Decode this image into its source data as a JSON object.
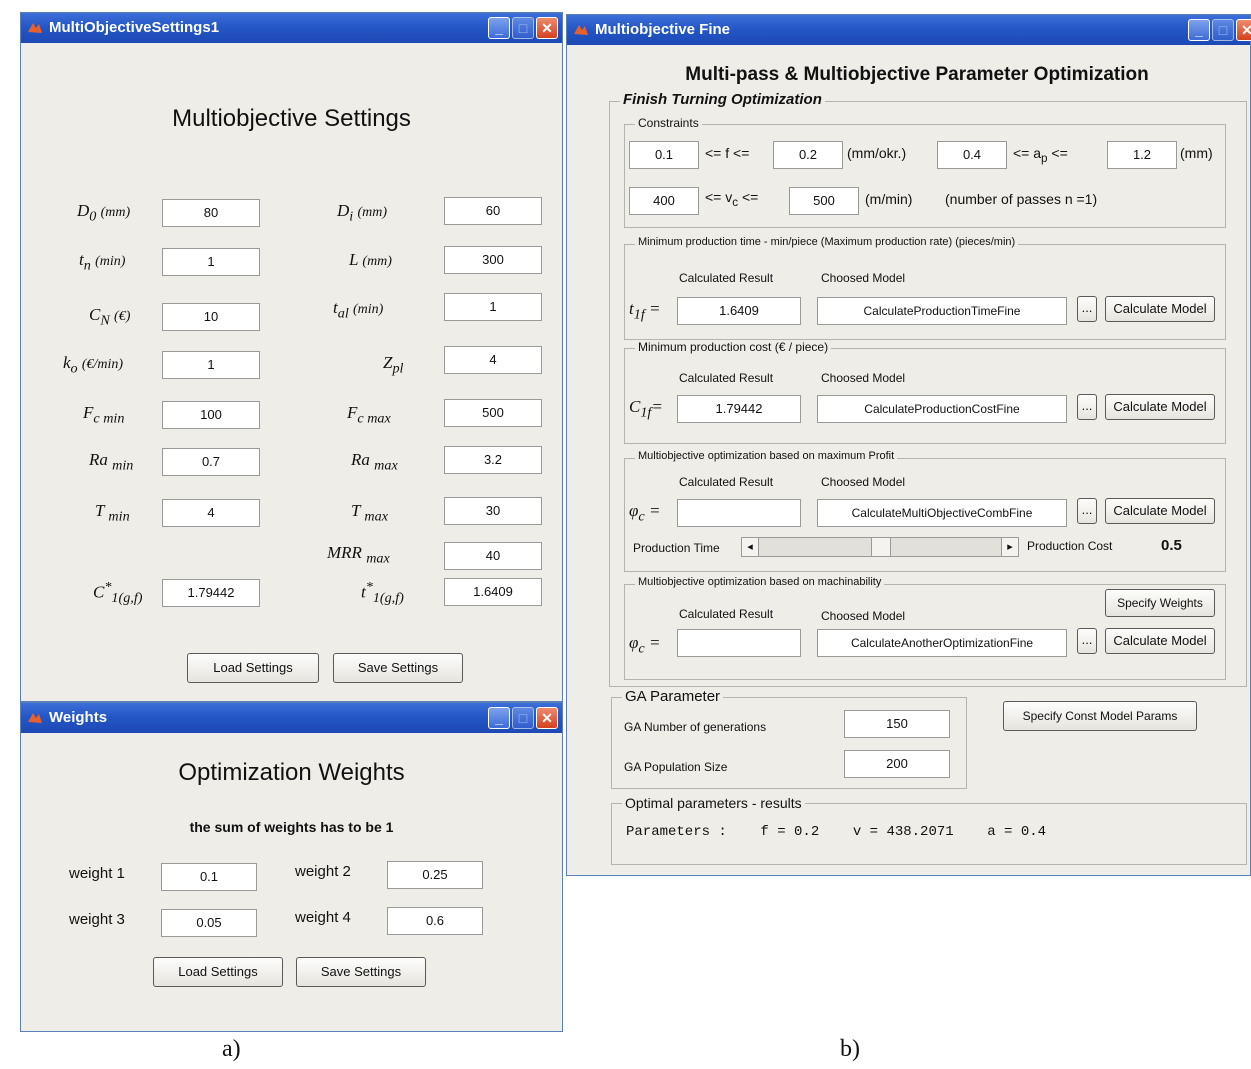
{
  "settings_window": {
    "title": "MultiObjectiveSettings1",
    "heading": "Multiobjective Settings",
    "fields": {
      "d0": {
        "label": "D",
        "sub": "0",
        "unit": "(mm)",
        "value": "80"
      },
      "di": {
        "label": "D",
        "sub": "i",
        "unit": "(mm)",
        "value": "60"
      },
      "tn": {
        "label": "t",
        "sub": "n",
        "unit": "(min)",
        "value": "1"
      },
      "l": {
        "label": "L",
        "unit": "(mm)",
        "value": "300"
      },
      "cn": {
        "label": "C",
        "sub": "N",
        "unit": "(€)",
        "value": "10"
      },
      "tal": {
        "label": "t",
        "sub": "al",
        "unit": "(min)",
        "value": "1"
      },
      "ko": {
        "label": "k",
        "sub": "o",
        "unit": "(€/min)",
        "value": "1"
      },
      "zpl": {
        "label": "Z",
        "sub": "pl",
        "value": "4"
      },
      "fcmin": {
        "label": "F",
        "sub": "c min",
        "value": "100"
      },
      "fcmax": {
        "label": "F",
        "sub": "c max",
        "value": "500"
      },
      "ramin": {
        "label": "Ra",
        "sub": "min",
        "value": "0.7"
      },
      "ramax": {
        "label": "Ra",
        "sub": "max",
        "value": "3.2"
      },
      "tmin": {
        "label": "T",
        "sub": "min",
        "value": "4"
      },
      "tmax": {
        "label": "T",
        "sub": "max",
        "value": "30"
      },
      "mrrmax": {
        "label": "MRR",
        "sub": "max",
        "value": "40"
      },
      "c1": {
        "label": "C",
        "sup": "*",
        "sub": "1(g,f)",
        "value": "1.79442"
      },
      "t1": {
        "label": "t",
        "sup": "*",
        "sub": "1(g,f)",
        "value": "1.6409"
      }
    },
    "load_label": "Load Settings",
    "save_label": "Save Settings"
  },
  "weights_window": {
    "title": "Weights",
    "heading": "Optimization Weights",
    "note": "the sum of weights has to be 1",
    "weights": [
      {
        "label": "weight 1",
        "value": "0.1"
      },
      {
        "label": "weight 2",
        "value": "0.25"
      },
      {
        "label": "weight 3",
        "value": "0.05"
      },
      {
        "label": "weight 4",
        "value": "0.6"
      }
    ],
    "load_label": "Load Settings",
    "save_label": "Save Settings"
  },
  "fine_window": {
    "title": "Multiobjective Fine",
    "heading": "Multi-pass & Multiobjective Parameter Optimization",
    "section_title": "Finish Turning Optimization",
    "constraints": {
      "title": "Constraints",
      "f_min": "0.1",
      "f_op": "<= f <=",
      "f_max": "0.2",
      "f_unit": "(mm/okr.)",
      "ap_min": "0.4",
      "ap_op": "<= a",
      "ap_sub": "p",
      "ap_op2": "<=",
      "ap_max": "1.2",
      "ap_unit": "(mm)",
      "vc_min": "400",
      "vc_op": "<= v",
      "vc_sub": "c",
      "vc_op2": "<=",
      "vc_max": "500",
      "vc_unit": "(m/min)",
      "passes": "(number of passes n =1)"
    },
    "col_result": "Calculated Result",
    "col_model": "Choosed Model",
    "calc_label": "Calculate Model",
    "browse_label": "...",
    "time_group": {
      "title": "Minimum production time - min/piece (Maximum production rate) (pieces/min)",
      "symbol": "t",
      "sub": "1f",
      "eq": "=",
      "result": "1.6409",
      "model": "CalculateProductionTimeFine"
    },
    "cost_group": {
      "title": "Minimum production cost  (€ / piece)",
      "symbol": "C",
      "sub": "1f",
      "eq": "=",
      "result": "1.79442",
      "model": "CalculateProductionCostFine"
    },
    "profit_group": {
      "title": "Multiobjective optimization based on maximum Profit",
      "symbol": "φ",
      "sub": "c",
      "eq": "=",
      "result": "",
      "model": "CalculateMultiObjectiveCombFine",
      "slider_left": "Production Time",
      "slider_right": "Production Cost",
      "slider_value": "0.5"
    },
    "mach_group": {
      "title": "Multiobjective optimization based on machinability",
      "symbol": "φ",
      "sub": "c",
      "eq": "=",
      "result": "",
      "model": "CalculateAnotherOptimizationFine",
      "weights_label": "Specify Weights"
    },
    "ga": {
      "title": "GA Parameter",
      "gen_label": "GA Number of generations",
      "gen_value": "150",
      "pop_label": "GA Population Size",
      "pop_value": "200"
    },
    "const_params_label": "Specify Const Model Params",
    "results": {
      "title": "Optimal parameters - results",
      "text": "Parameters :    f = 0.2    v = 438.2071    a = 0.4"
    }
  },
  "captions": {
    "a": "a)",
    "b": "b)"
  },
  "colors": {
    "titlebar": "#2457c7",
    "window_bg": "#efede8",
    "close": "#d4401e"
  }
}
